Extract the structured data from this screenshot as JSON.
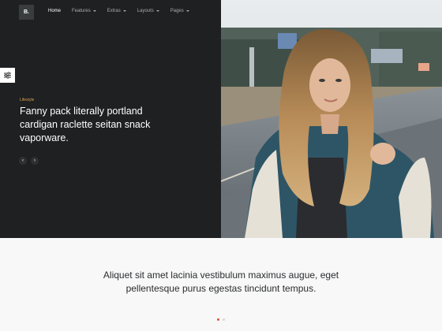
{
  "header": {
    "logo": "B.",
    "nav": [
      {
        "label": "Home",
        "dropdown": false,
        "active": true
      },
      {
        "label": "Features",
        "dropdown": true,
        "active": false
      },
      {
        "label": "Extras",
        "dropdown": true,
        "active": false
      },
      {
        "label": "Layouts",
        "dropdown": true,
        "active": false
      },
      {
        "label": "Pages",
        "dropdown": true,
        "active": false
      }
    ]
  },
  "hero": {
    "kicker": "Lifestyle",
    "headline": "Fanny pack literally portland cardigan raclette seitan snack vaporware.",
    "prev_icon": "chevron-left-icon",
    "next_icon": "chevron-right-icon",
    "image": "photo of young woman with long blonde hair in denim jacket on a roadside",
    "side_toggle_icon": "sliders-icon"
  },
  "testimonial": {
    "quote": "Aliquet sit amet lacinia vestibulum maximus augue, eget pellentesque purus egestas tincidunt tempus.",
    "pagination": {
      "count": 2,
      "active": 1
    }
  },
  "colors": {
    "dark_panel": "#1e2022",
    "accent": "#d8a24c",
    "dot_active": "#e04f3a",
    "light_section": "#f8f8f8"
  }
}
